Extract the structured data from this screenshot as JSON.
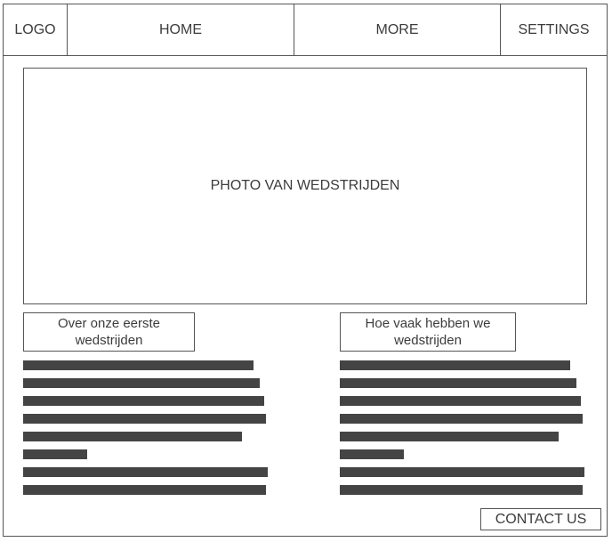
{
  "nav": {
    "logo": "LOGO",
    "home": "HOME",
    "more": "MORE",
    "settings": "SETTINGS"
  },
  "hero": {
    "photo_label": "PHOTO VAN WEDSTRIJDEN"
  },
  "sections": {
    "left": {
      "heading": "Over onze eerste wedstrijden"
    },
    "right": {
      "heading": "Hoe vaak hebben we wedstrijden"
    }
  },
  "footer": {
    "contact_label": "CONTACT US"
  },
  "colors": {
    "border": "#555555",
    "text": "#3c3c3c",
    "placeholder_line": "#444444",
    "background": "#ffffff"
  }
}
